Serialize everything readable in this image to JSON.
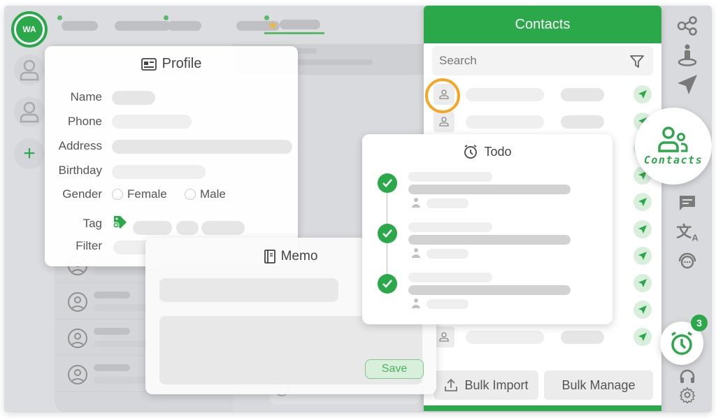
{
  "app": {
    "logo_text": "WA",
    "accent_color": "#2ba84a",
    "highlight_color": "#f5a623"
  },
  "tabs": [
    {
      "has_dot": true,
      "active": false
    },
    {
      "has_dot": false,
      "active": false
    },
    {
      "has_dot": true,
      "active": false
    },
    {
      "has_dot": false,
      "active": false
    },
    {
      "has_dot": true,
      "active": true,
      "icon": "star-icon"
    }
  ],
  "profile": {
    "title": "Profile",
    "fields": {
      "name_label": "Name",
      "phone_label": "Phone",
      "address_label": "Address",
      "birthday_label": "Birthday",
      "gender_label": "Gender",
      "tag_label": "Tag",
      "filter_label": "Filter"
    },
    "gender_options": [
      "Female",
      "Male"
    ]
  },
  "memo": {
    "title": "Memo",
    "save_label": "Save"
  },
  "contacts": {
    "title": "Contacts",
    "search_placeholder": "Search",
    "row_count": 10,
    "bulk_import_label": "Bulk Import",
    "bulk_manage_label": "Bulk Manage"
  },
  "todo": {
    "title": "Todo",
    "items_count": 3
  },
  "right_rail": {
    "contacts_bubble_label": "Contacts",
    "todo_badge_count": "3"
  }
}
